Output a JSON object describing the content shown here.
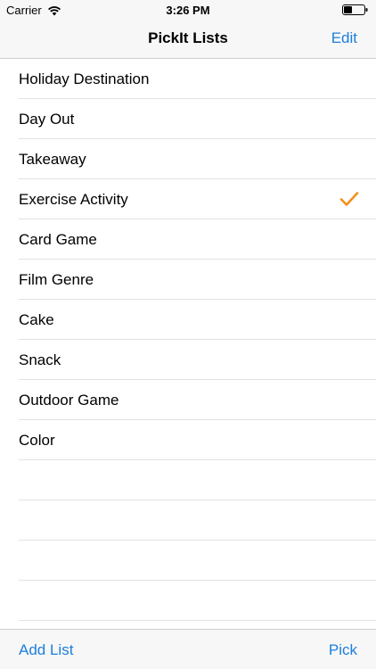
{
  "status_bar": {
    "carrier": "Carrier",
    "time": "3:26 PM",
    "icons": [
      "wifi-icon",
      "battery-icon"
    ]
  },
  "nav": {
    "title": "PickIt Lists",
    "edit_label": "Edit"
  },
  "lists": [
    {
      "label": "Holiday Destination",
      "checked": false
    },
    {
      "label": "Day Out",
      "checked": false
    },
    {
      "label": "Takeaway",
      "checked": false
    },
    {
      "label": "Exercise Activity",
      "checked": true
    },
    {
      "label": "Card Game",
      "checked": false
    },
    {
      "label": "Film Genre",
      "checked": false
    },
    {
      "label": "Cake",
      "checked": false
    },
    {
      "label": "Snack",
      "checked": false
    },
    {
      "label": "Outdoor Game",
      "checked": false
    },
    {
      "label": "Color",
      "checked": false
    }
  ],
  "toolbar": {
    "add_list_label": "Add List",
    "pick_label": "Pick"
  },
  "colors": {
    "accent": "#1b7fdb",
    "checkmark": "#f0901a"
  }
}
